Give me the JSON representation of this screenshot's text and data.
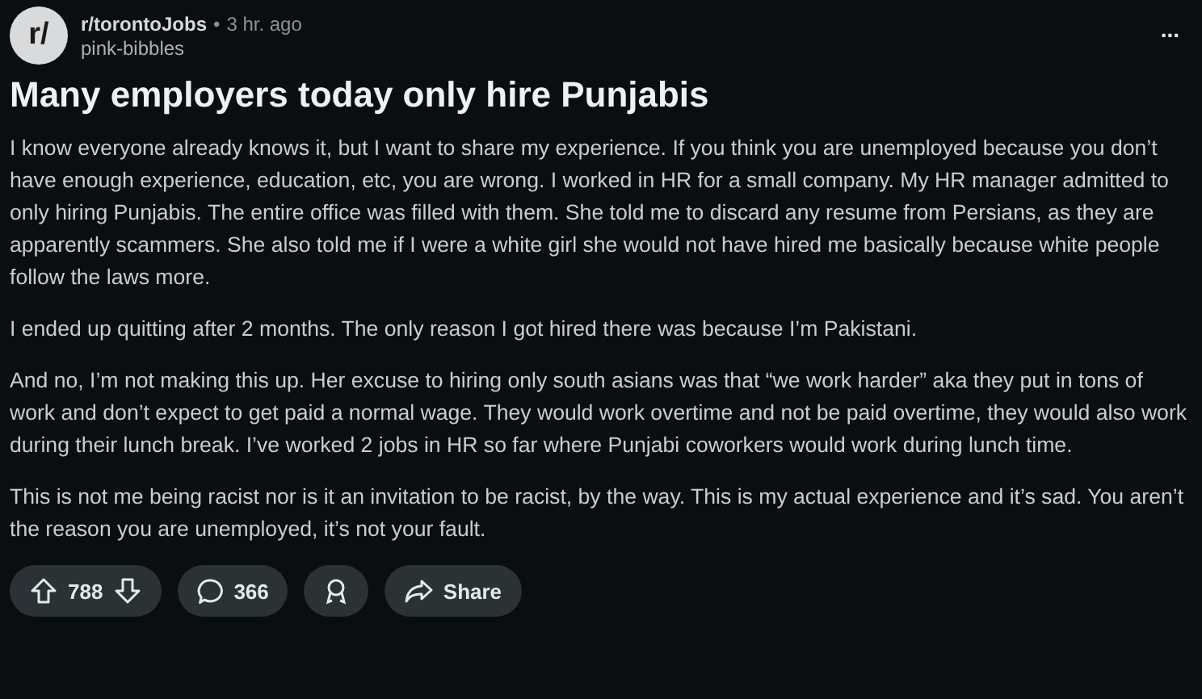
{
  "post": {
    "avatar": "r/",
    "subreddit": "r/torontoJobs",
    "separator": "•",
    "time": "3 hr. ago",
    "author": "pink-bibbles",
    "more": "...",
    "title": "Many employers today only hire Punjabis",
    "paragraphs": [
      "I know everyone already knows it, but I want to share my experience. If you think you are unemployed because you don’t have enough experience, education, etc, you are wrong. I worked in HR for a small company. My HR manager admitted to only hiring Punjabis. The entire office was filled with them. She told me to discard any resume from Persians, as they are apparently scammers. She also told me if I were a white girl she would not have hired me basically because white people follow the laws more.",
      "I ended up quitting after 2 months. The only reason I got hired there was because I’m Pakistani.",
      "And no, I’m not making this up. Her excuse to hiring only south asians was that “we work harder” aka they put in tons of work and don’t expect to get paid a normal wage. They would work overtime and not be paid overtime, they would also work during their lunch break. I’ve worked 2 jobs in HR so far where Punjabi coworkers would work during lunch time.",
      "This is not me being racist nor is it an invitation to be racist, by the way. This is my actual experience and it’s sad. You aren’t the reason you are unemployed, it’s not your fault."
    ]
  },
  "actions": {
    "votes": "788",
    "comments": "366",
    "share": "Share"
  }
}
